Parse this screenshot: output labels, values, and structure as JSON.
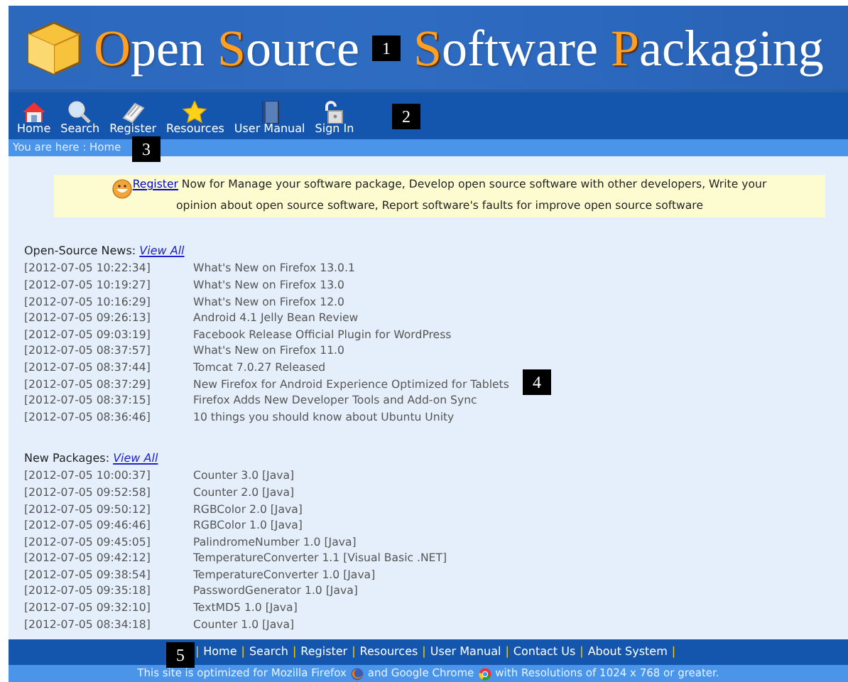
{
  "header": {
    "title_words": [
      {
        "initial": "O",
        "rest": "pen"
      },
      {
        "initial": "S",
        "rest": "ource"
      },
      {
        "initial": "S",
        "rest": "oftware"
      },
      {
        "initial": "P",
        "rest": "ackaging"
      }
    ]
  },
  "nav": [
    {
      "kind": "home",
      "label": "Home"
    },
    {
      "kind": "search",
      "label": "Search"
    },
    {
      "kind": "register",
      "label": "Register"
    },
    {
      "kind": "resources",
      "label": "Resources"
    },
    {
      "kind": "manual",
      "label": "User Manual"
    },
    {
      "kind": "signin",
      "label": "Sign In"
    }
  ],
  "breadcrumb": "You are here : Home",
  "banner": {
    "link": "Register",
    "text": " Now for Manage your software package, Develop open source software with other developers, Write your opinion about open source software, Report software's faults for improve open source software"
  },
  "sections": [
    {
      "title": "Open-Source News:",
      "view_all": "View All",
      "rows": [
        {
          "time": "[2012-07-05 10:22:34]",
          "title": "What's New on Firefox 13.0.1"
        },
        {
          "time": "[2012-07-05 10:19:27]",
          "title": "What's New on Firefox 13.0"
        },
        {
          "time": "[2012-07-05 10:16:29]",
          "title": "What's New on Firefox 12.0"
        },
        {
          "time": "[2012-07-05 09:26:13]",
          "title": "Android 4.1 Jelly Bean Review"
        },
        {
          "time": "[2012-07-05 09:03:19]",
          "title": "Facebook Release Official Plugin for WordPress"
        },
        {
          "time": "[2012-07-05 08:37:57]",
          "title": "What's New on Firefox 11.0"
        },
        {
          "time": "[2012-07-05 08:37:44]",
          "title": "Tomcat 7.0.27 Released"
        },
        {
          "time": "[2012-07-05 08:37:29]",
          "title": "New Firefox for Android Experience Optimized for Tablets"
        },
        {
          "time": "[2012-07-05 08:37:15]",
          "title": "Firefox Adds New Developer Tools and Add-on Sync"
        },
        {
          "time": "[2012-07-05 08:36:46]",
          "title": "10 things you should know about Ubuntu Unity"
        }
      ]
    },
    {
      "title": "New Packages:",
      "view_all": "View All",
      "rows": [
        {
          "time": "[2012-07-05 10:00:37]",
          "title": "Counter 3.0 [Java]"
        },
        {
          "time": "[2012-07-05 09:52:58]",
          "title": "Counter 2.0 [Java]"
        },
        {
          "time": "[2012-07-05 09:50:12]",
          "title": "RGBColor 2.0 [Java]"
        },
        {
          "time": "[2012-07-05 09:46:46]",
          "title": "RGBColor 1.0 [Java]"
        },
        {
          "time": "[2012-07-05 09:45:05]",
          "title": "PalindromeNumber 1.0 [Java]"
        },
        {
          "time": "[2012-07-05 09:42:12]",
          "title": "TemperatureConverter 1.1 [Visual Basic .NET]"
        },
        {
          "time": "[2012-07-05 09:38:54]",
          "title": "TemperatureConverter 1.0 [Java]"
        },
        {
          "time": "[2012-07-05 09:35:18]",
          "title": "PasswordGenerator 1.0 [Java]"
        },
        {
          "time": "[2012-07-05 09:32:10]",
          "title": "TextMD5 1.0 [Java]"
        },
        {
          "time": "[2012-07-05 08:34:18]",
          "title": "Counter 1.0 [Java]"
        }
      ]
    }
  ],
  "footer": {
    "links": [
      "Home",
      "Search",
      "Register",
      "Resources",
      "User Manual",
      "Contact Us",
      "About System"
    ],
    "separator": "|",
    "note_parts": [
      "This site is optimized for Mozilla Firefox",
      "and Google Chrome",
      "with Resolutions of 1024 x 768 or greater."
    ]
  },
  "callouts": [
    "1",
    "2",
    "3",
    "4",
    "5"
  ]
}
